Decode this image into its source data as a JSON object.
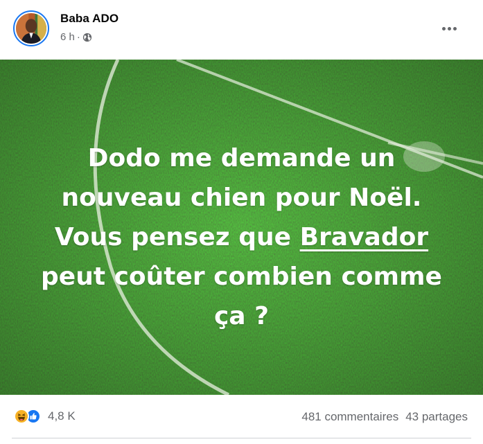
{
  "post": {
    "author": "Baba ADO",
    "time": "6 h",
    "separator": "·",
    "privacy_icon": "globe-icon",
    "options_icon": "more-horizontal-icon",
    "image_text": {
      "line1": "Dodo me demande un",
      "line2": "nouveau chien pour Noël.",
      "line3_before": "Vous pensez que ",
      "line3_mention": "Bravador",
      "line4": "peut coûter combien comme",
      "line5": "ça ?"
    },
    "reactions": {
      "icons": [
        "haha-reaction-icon",
        "like-reaction-icon"
      ],
      "count": "4,8 K"
    },
    "comments": "481 commentaires",
    "shares": "43 partages"
  },
  "colors": {
    "like_blue": "#1877f2",
    "haha_yellow": "#f7b125",
    "secondary_text": "#65676b",
    "grass_green": "#2e6e21"
  }
}
